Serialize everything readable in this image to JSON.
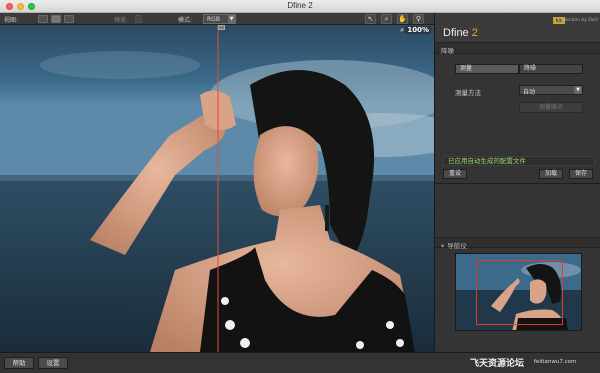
{
  "window": {
    "title": "Dfine 2"
  },
  "toolbar": {
    "view_label": "视图:",
    "preview_label": "预览:",
    "mode_label": "模式:",
    "mode_value": "RGB",
    "zoom": "100%",
    "icons": [
      "arrow-tool-icon",
      "zoom-tool-icon",
      "hand-tool-icon",
      "pin-tool-icon"
    ]
  },
  "panel": {
    "brand_badge": "NIK",
    "brand_by": "Collection by DxO",
    "product_name": "Dfine",
    "product_version": "2",
    "section_measure": "降噪",
    "tabs": [
      "测量",
      "降噪"
    ],
    "method_label": "测量方法",
    "method_value": "自动",
    "measure_noise_button": "测量噪点",
    "status_text": "已应用自动生成的配置文件",
    "reset_button": "重设",
    "load_button": "加载",
    "save_button": "保存",
    "section_navigator": "导航仪"
  },
  "bottom": {
    "help_button": "帮助",
    "settings_button": "设置",
    "watermark": "飞天资源论坛",
    "watermark_url": "feitianwu7.com"
  }
}
